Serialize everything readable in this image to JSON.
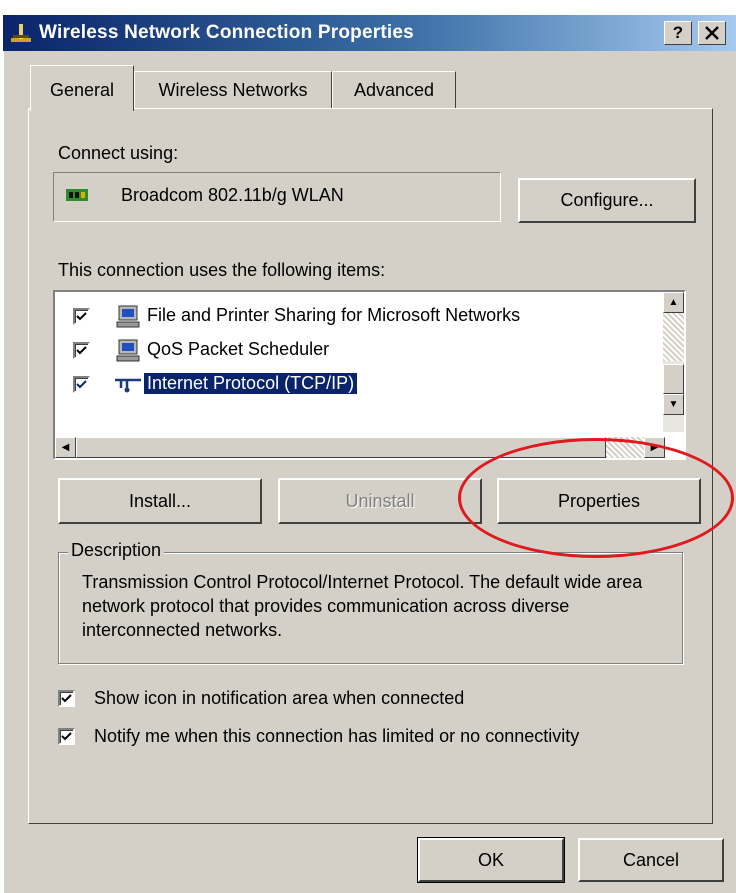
{
  "window": {
    "title": "Wireless Network Connection Properties",
    "help_label": "?",
    "close_label": "✕"
  },
  "tabs": [
    {
      "label": "General",
      "active": true
    },
    {
      "label": "Wireless Networks",
      "active": false
    },
    {
      "label": "Advanced",
      "active": false
    }
  ],
  "general": {
    "connect_using_label": "Connect using:",
    "adapter_name": "Broadcom 802.11b/g WLAN",
    "configure_button": "Configure...",
    "items_label": "This connection uses the following items:",
    "items": [
      {
        "label": "File and Printer Sharing for Microsoft Networks",
        "checked": true,
        "icon": "network-computer-icon"
      },
      {
        "label": "QoS Packet Scheduler",
        "checked": true,
        "icon": "network-computer-icon"
      },
      {
        "label": "Internet Protocol (TCP/IP)",
        "checked": true,
        "selected": true,
        "icon": "protocol-icon"
      }
    ],
    "install_button": "Install...",
    "uninstall_button": "Uninstall",
    "properties_button": "Properties",
    "description_legend": "Description",
    "description_text": "Transmission Control Protocol/Internet Protocol. The default wide area network protocol that provides communication across diverse interconnected networks.",
    "show_icon_label": "Show icon in notification area when connected",
    "show_icon_checked": true,
    "notify_label": "Notify me when this connection has limited or no connectivity",
    "notify_checked": true
  },
  "footer": {
    "ok_button": "OK",
    "cancel_button": "Cancel"
  },
  "colors": {
    "dialog_face": "#d4d0c8",
    "titlebar_start": "#0a246a",
    "titlebar_end": "#a6caf0",
    "selection": "#0a246a",
    "annotation_circle": "#e0191f"
  }
}
